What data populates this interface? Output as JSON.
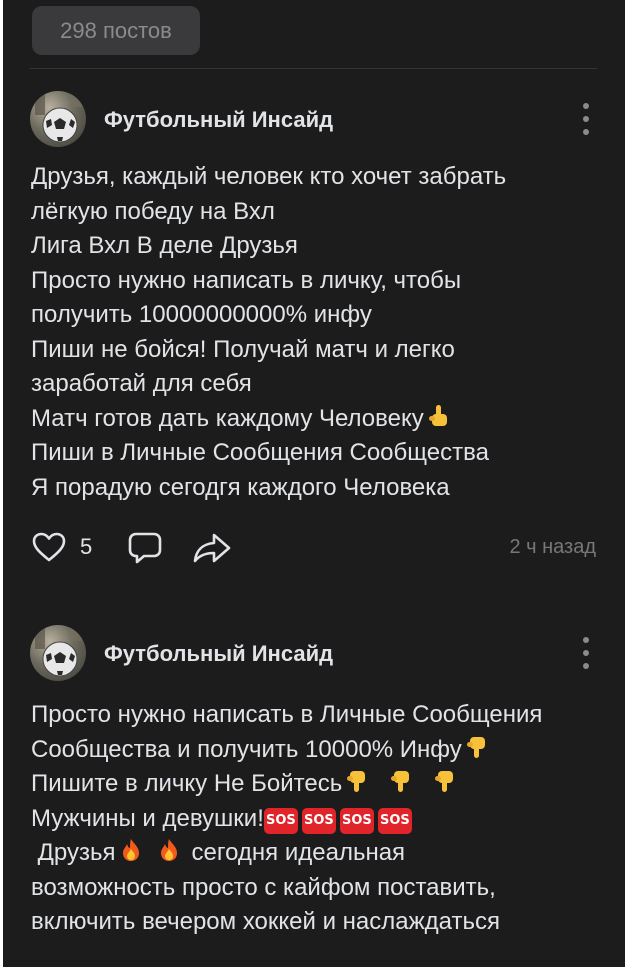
{
  "feed": {
    "posts_count": "298 постов"
  },
  "posts": [
    {
      "author": "Футбольный Инсайд",
      "avatar_icon": "soccer-ball-avatar",
      "menu_icon": "more-vertical-icon",
      "lines": [
        "Друзья, каждый человек кто хочет забрать",
        "лёгкую победу на Вхл",
        "Лига Вхл В деле Друзья",
        "Просто нужно написать в личку, чтобы",
        "получить 10000000000% инфу",
        "Пиши не бойся! Получай матч и легко",
        "заработай для себя",
        "Матч готов дать каждому Человеку",
        "Пиши в Личные Сообщения Сообщества",
        "Я порадую сегодгя каждого Человека"
      ],
      "emoji_after_line_8": "index-pointing-up-emoji",
      "likes": "5",
      "time": "2 ч назад"
    },
    {
      "author": "Футбольный Инсайд",
      "avatar_icon": "soccer-ball-avatar",
      "menu_icon": "more-vertical-icon",
      "lines": [
        "Просто нужно написать в Личные Сообщения",
        "Сообщества и получить 10000% Инфу",
        "Пишите в личку Не Бойтесь",
        "Мужчины и девушки!",
        " Друзья",
        "сегодня идеальная",
        "возможность просто с кайфом поставить,",
        "включить вечером хоккей и наслаждаться"
      ],
      "sos_label": "SOS"
    }
  ],
  "colors": {
    "background": "#1c1c1d",
    "chip": "#3a3a3c",
    "text": "#e1e3e6",
    "secondary": "#76787a",
    "sos": "#e0242a"
  }
}
